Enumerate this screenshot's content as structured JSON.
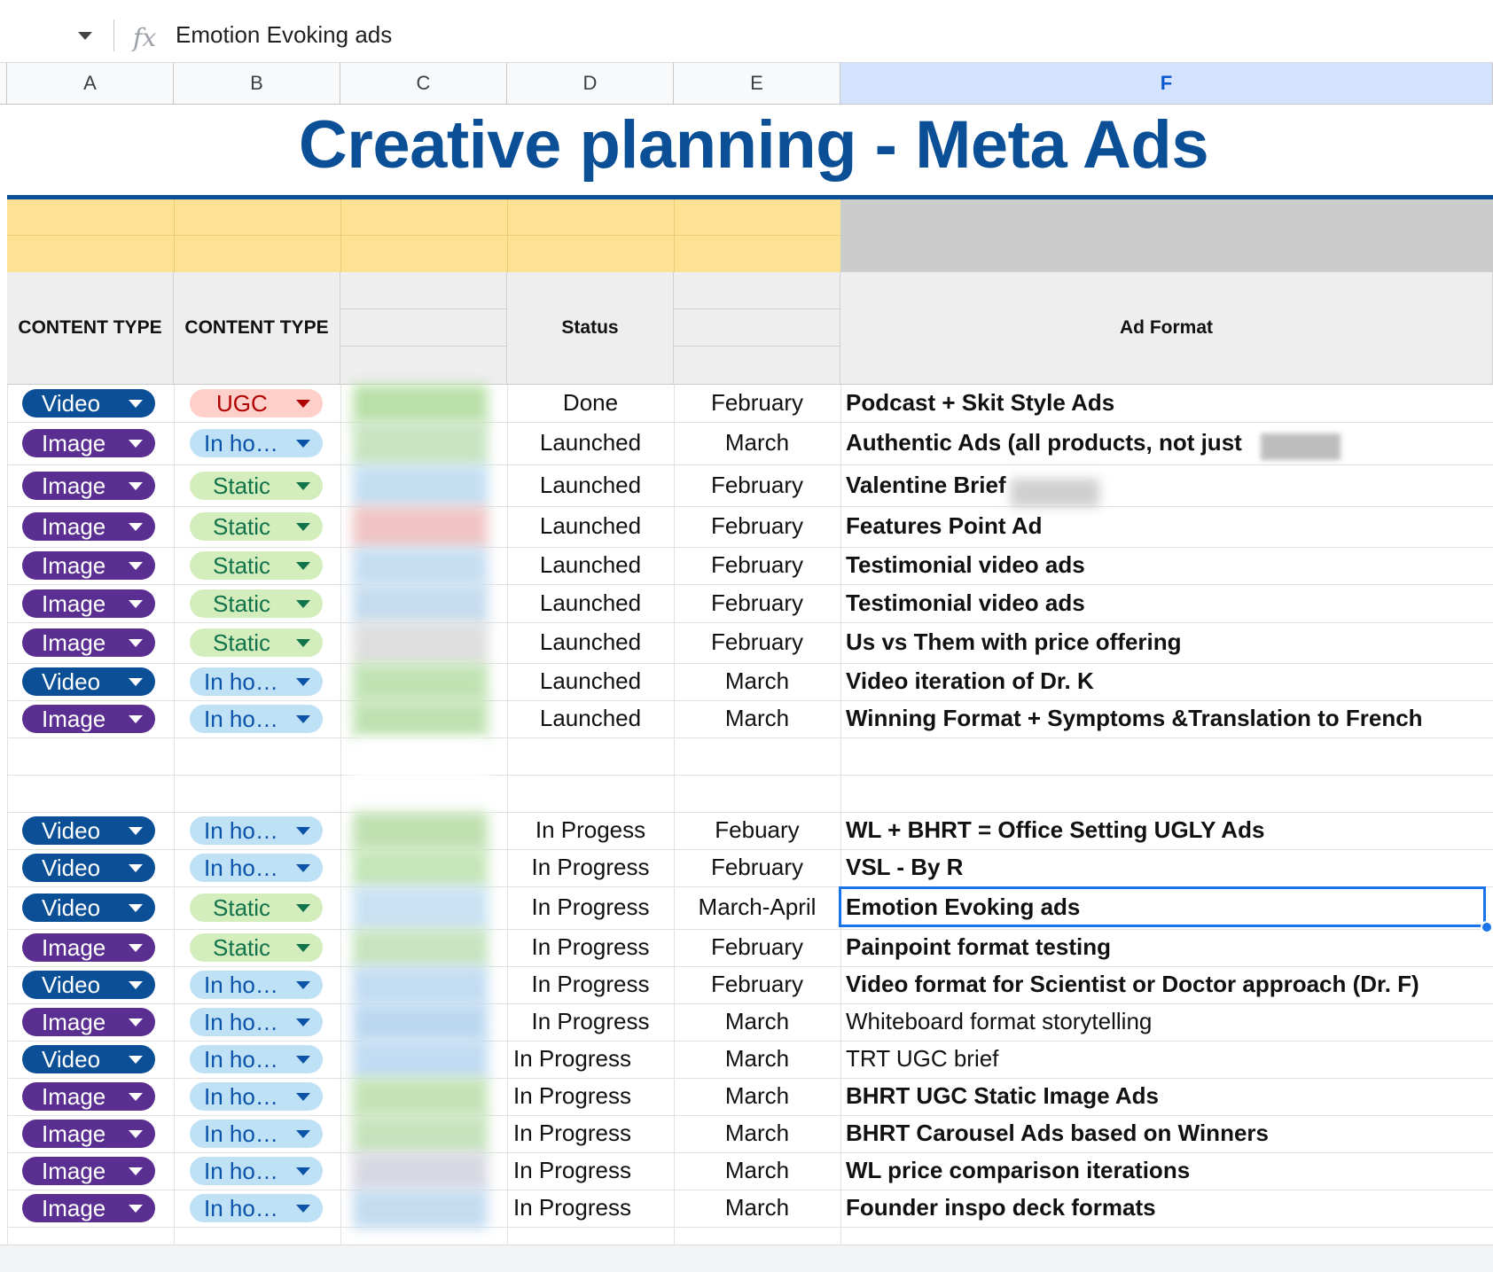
{
  "formula_bar": {
    "fx_symbol": "fx",
    "value": "Emotion Evoking ads"
  },
  "columns": [
    "A",
    "B",
    "C",
    "D",
    "E",
    "F"
  ],
  "selected_column": "F",
  "title": "Creative planning - Meta Ads",
  "headers": {
    "a": "CONTENT TYPE",
    "b": "CONTENT TYPE",
    "d": "Status",
    "f": "Ad Format"
  },
  "colors": {
    "title": "#0b4f96",
    "yellow_band": "#fde293",
    "gray_band": "#cccccc",
    "selection": "#1a73e8",
    "video_chip": "#0b4f96",
    "image_chip": "#5b2f91",
    "ugc_chip": "#ffcfc9",
    "static_chip": "#d4edbc",
    "inhouse_chip": "#bfe1f6"
  },
  "rows": [
    {
      "a": "Video",
      "b": "UGC",
      "status": "Done",
      "month": "February",
      "format": "Podcast + Skit Style Ads",
      "bold": true,
      "blur": "#b9e0a8"
    },
    {
      "a": "Image",
      "b": "In ho…",
      "status": "Launched",
      "month": "March",
      "format": "Authentic Ads (all products, not just",
      "bold": true,
      "blur": "#c7e4c0"
    },
    {
      "a": "Image",
      "b": "Static",
      "status": "Launched",
      "month": "February",
      "format": "Valentine Brief",
      "bold": true,
      "blur": "#c4dff2"
    },
    {
      "a": "Image",
      "b": "Static",
      "status": "Launched",
      "month": "February",
      "format": "Features Point Ad",
      "bold": true,
      "blur": "#f0c4c4"
    },
    {
      "a": "Image",
      "b": "Static",
      "status": "Launched",
      "month": "February",
      "format": "Testimonial video ads",
      "bold": true,
      "blur": "#c6def2"
    },
    {
      "a": "Image",
      "b": "Static",
      "status": "Launched",
      "month": "February",
      "format": "Testimonial video ads",
      "bold": true,
      "blur": "#c4dcef"
    },
    {
      "a": "Image",
      "b": "Static",
      "status": "Launched",
      "month": "February",
      "format": "Us vs Them with price offering",
      "bold": true,
      "blur": "#dedede"
    },
    {
      "a": "Video",
      "b": "In ho…",
      "status": "Launched",
      "month": "March",
      "format": "Video iteration of Dr. K",
      "bold": true,
      "blur": "#c0e3b4"
    },
    {
      "a": "Image",
      "b": "In ho…",
      "status": "Launched",
      "month": "March",
      "format": "Winning Format + Symptoms &Translation to French",
      "bold": true,
      "blur": "#bfe2b2"
    },
    {
      "a": "",
      "b": "",
      "status": "",
      "month": "",
      "format": "",
      "bold": false,
      "blur": "#ffffff"
    },
    {
      "a": "",
      "b": "",
      "status": "",
      "month": "",
      "format": "",
      "bold": false,
      "blur": "#ffffff"
    },
    {
      "a": "Video",
      "b": "In ho…",
      "status": "In Progess",
      "month": "Febuary",
      "format": "WL + BHRT = Office Setting UGLY Ads",
      "bold": true,
      "blur": "#bfe0b1"
    },
    {
      "a": "Video",
      "b": "In ho…",
      "status": "In Progress",
      "month": "February",
      "format": "VSL - By R",
      "bold": true,
      "blur": "#c4e6b8"
    },
    {
      "a": "Video",
      "b": "Static",
      "status": "In Progress",
      "month": "March-April",
      "format": "Emotion Evoking ads",
      "bold": true,
      "blur": "#c8e2f3"
    },
    {
      "a": "Image",
      "b": "Static",
      "status": "In Progress",
      "month": "February",
      "format": "Painpoint format testing",
      "bold": true,
      "blur": "#c6e4be"
    },
    {
      "a": "Video",
      "b": "In ho…",
      "status": "In Progress",
      "month": "February",
      "format": "Video format for Scientist or Doctor approach (Dr. F)",
      "bold": true,
      "blur": "#c2dcf2"
    },
    {
      "a": "Image",
      "b": "In ho…",
      "status": "In Progress",
      "month": "March",
      "format": "Whiteboard format storytelling",
      "bold": false,
      "blur": "#bcd8f0"
    },
    {
      "a": "Video",
      "b": "In ho…",
      "status": "In Progress",
      "month": "March",
      "format": "TRT UGC brief",
      "bold": false,
      "blur": "#c0dbf2"
    },
    {
      "a": "Image",
      "b": "In ho…",
      "status": "In Progress",
      "month": "March",
      "format": "BHRT UGC Static Image Ads",
      "bold": true,
      "blur": "#c3e3b6"
    },
    {
      "a": "Image",
      "b": "In ho…",
      "status": "In Progress",
      "month": "March",
      "format": "BHRT Carousel Ads based on Winners",
      "bold": true,
      "blur": "#c5e3bc"
    },
    {
      "a": "Image",
      "b": "In ho…",
      "status": "In Progress",
      "month": "March",
      "format": "WL price comparison iterations",
      "bold": true,
      "blur": "#d8d8e2"
    },
    {
      "a": "Image",
      "b": "In ho…",
      "status": "In Progress",
      "month": "March",
      "format": "Founder inspo deck formats",
      "bold": true,
      "blur": "#c4dcf0"
    }
  ]
}
